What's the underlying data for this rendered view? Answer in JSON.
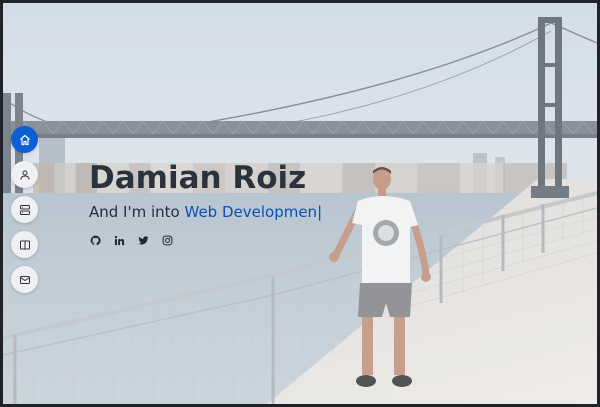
{
  "hero": {
    "name": "Damian Roiz",
    "subtitle_prefix": "And I'm into ",
    "subtitle_typed": "Web Developmen",
    "cursor": "|"
  },
  "nav": {
    "items": [
      {
        "icon": "home-icon",
        "active": true
      },
      {
        "icon": "user-icon",
        "active": false
      },
      {
        "icon": "server-icon",
        "active": false
      },
      {
        "icon": "book-icon",
        "active": false
      },
      {
        "icon": "mail-icon",
        "active": false
      }
    ]
  },
  "socials": [
    {
      "icon": "github-icon"
    },
    {
      "icon": "linkedin-icon"
    },
    {
      "icon": "twitter-icon"
    },
    {
      "icon": "instagram-icon"
    }
  ],
  "colors": {
    "accent": "#0d5fd6",
    "title": "#2a323d",
    "nav_bg": "#eef0f3"
  }
}
